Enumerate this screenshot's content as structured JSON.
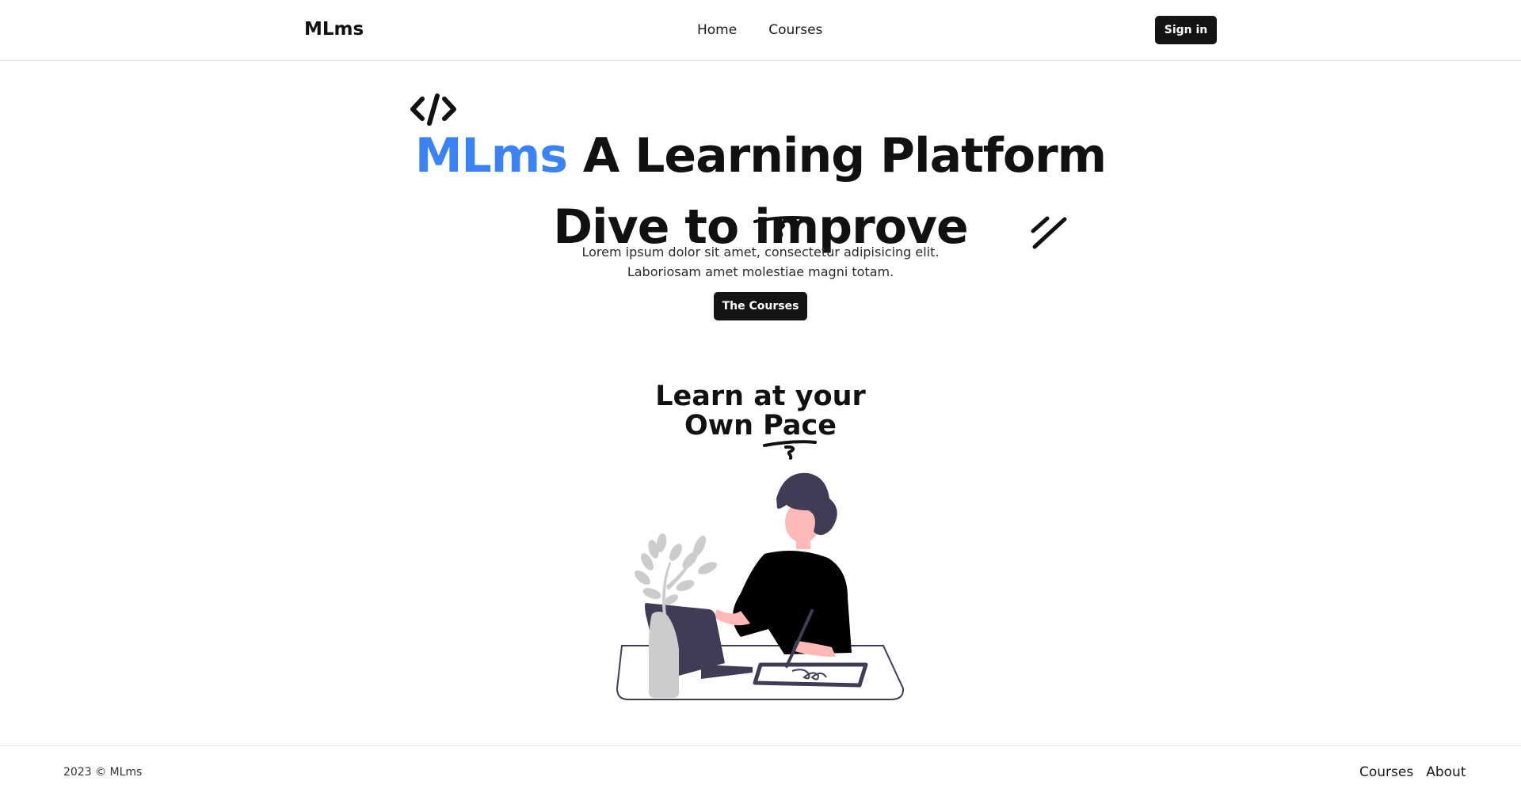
{
  "header": {
    "brand": "MLms",
    "nav": [
      "Home",
      "Courses"
    ],
    "sign_in_label": "Sign in"
  },
  "hero": {
    "title_accent": "MLms",
    "title_rest": "A Learning Platform",
    "title_line2": "Dive to improve",
    "subtitle_line1": "Lorem ipsum dolor sit amet, consectetur adipisicing elit.",
    "subtitle_line2": "Laboriosam amet molestiae magni totam.",
    "cta_label": "The Courses"
  },
  "section": {
    "title_line1": "Learn at your",
    "title_line2": "Own Pace"
  },
  "footer": {
    "copyright": "2023 © MLms",
    "links": [
      "Courses",
      "About"
    ]
  },
  "colors": {
    "accent": "#3b82f6",
    "button_bg": "#141414",
    "illustration_dark": "#3f3d56",
    "illustration_skin": "#ffb8b8",
    "illustration_plant": "#cccccc"
  },
  "icons": [
    "code-icon",
    "slash-lines-icon",
    "underline-scribble-icon",
    "woman-at-desk-illustration"
  ]
}
